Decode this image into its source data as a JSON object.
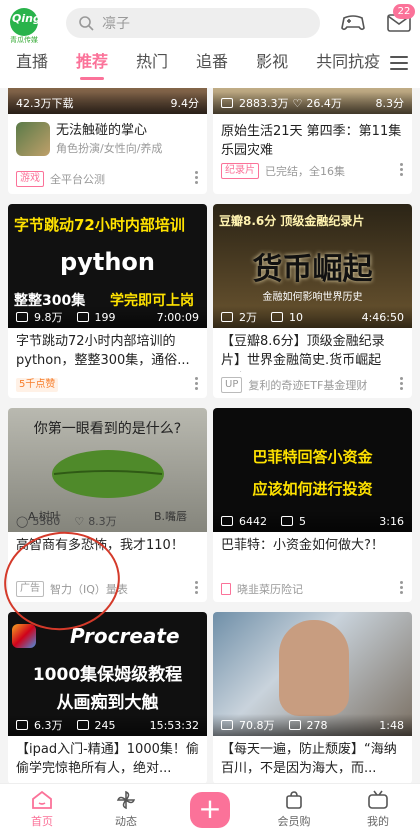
{
  "header": {
    "logo_text": "Qingua",
    "logo_sub": "青瓜传媒",
    "search_placeholder": "凛子",
    "message_badge": "22"
  },
  "tabs": [
    {
      "label": "直播"
    },
    {
      "label": "推荐"
    },
    {
      "label": "热门"
    },
    {
      "label": "追番"
    },
    {
      "label": "影视"
    },
    {
      "label": "共同抗疫"
    }
  ],
  "cards": [
    {
      "views": "42.3万下载",
      "rating": "9.4分",
      "title": "无法触碰的掌心",
      "subtitle": "角色扮演/女性向/养成",
      "tag": "游戏",
      "foot": "全平台公测"
    },
    {
      "views": "2883.3万",
      "likes": "26.4万",
      "rating": "8.3分",
      "title": "原始生活21天 第四季：第11集 乐园灾难",
      "tag": "纪录片",
      "foot": "已完结，全16集"
    },
    {
      "thumb_line1": "字节跳动72小时内部培训",
      "thumb_line2": "python",
      "thumb_line3": "整整300集",
      "thumb_line4": "学完即可上岗",
      "views": "9.8万",
      "danmaku": "199",
      "duration": "7:00:09",
      "title": "字节跳动72小时内部培训的python，整整300集，通俗...",
      "tag": "5千点赞"
    },
    {
      "thumb_line1": "豆瓣8.6分 顶级金融纪录片",
      "thumb_line2": "货币崛起",
      "thumb_line3": "金融如何影响世界历史",
      "views": "2万",
      "danmaku": "10",
      "duration": "4:46:50",
      "title": "【豆瓣8.6分】顶级金融纪录片】世界金融简史.货币崛起【全6...",
      "tag": "UP",
      "foot": "复利的奇迹ETF基金理财"
    },
    {
      "thumb_line1": "你第一眼看到的是什么?",
      "thumb_a": "A.树叶",
      "thumb_b": "B.嘴唇",
      "views": "5380",
      "likes": "8.3万",
      "title": "高智商有多恐怖，我才110！",
      "tag": "广告",
      "foot": "智力（IQ）量表"
    },
    {
      "thumb_line1": "巴菲特回答小资金",
      "thumb_line2": "应该如何进行投资",
      "views": "6442",
      "danmaku": "5",
      "duration": "3:16",
      "title": "巴菲特：小资金如何做大?！",
      "foot": "晓韭菜历险记"
    },
    {
      "thumb_line1": "Procreate",
      "thumb_line2": "1000集保姆级教程",
      "thumb_line3": "从画痴到大触",
      "views": "6.3万",
      "danmaku": "245",
      "duration": "15:53:32",
      "title": "【ipad入门-精通】1000集！偷偷学完惊艳所有人，绝对..."
    },
    {
      "views": "70.8万",
      "danmaku": "278",
      "duration": "1:48",
      "title": "【每天一遍，防止颓废】“海纳百川，不是因为海大，而..."
    }
  ],
  "bottom_nav": [
    {
      "label": "首页"
    },
    {
      "label": "动态"
    },
    {
      "label": "+"
    },
    {
      "label": "会员购"
    },
    {
      "label": "我的"
    }
  ],
  "colors": {
    "accent": "#fb7299",
    "annotation": "#d43a2a"
  }
}
